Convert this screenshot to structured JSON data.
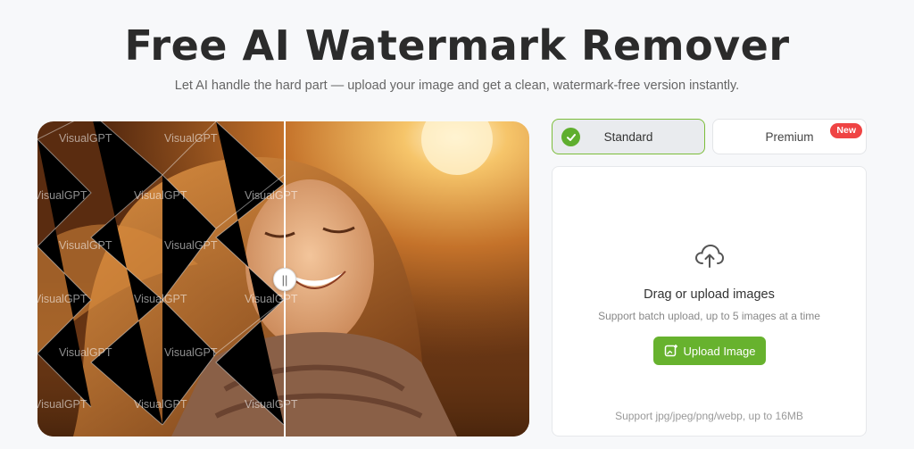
{
  "header": {
    "title": "Free AI Watermark Remover",
    "subtitle": "Let AI handle the hard part — upload your image and get a clean, watermark-free version instantly."
  },
  "preview": {
    "watermark_text": "VisualGPT",
    "watermark_text_upper": "VisualGPT",
    "handle_icon": "drag-handle-icon"
  },
  "modes": {
    "standard_label": "Standard",
    "premium_label": "Premium",
    "premium_badge": "New",
    "active": "Standard"
  },
  "upload": {
    "icon": "cloud-upload-icon",
    "title": "Drag or upload images",
    "subtitle": "Support batch upload, up to 5 images at a time",
    "button_label": "Upload Image",
    "footnote": "Support jpg/jpeg/png/webp, up to 16MB"
  },
  "colors": {
    "accent": "#67b22e",
    "badge": "#ef4444",
    "background": "#f7f8fa"
  }
}
